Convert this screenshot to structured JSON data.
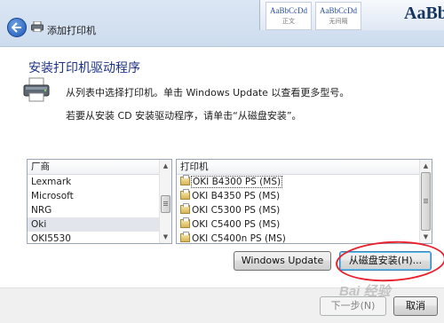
{
  "window": {
    "title": "添加打印机"
  },
  "office_ribbon": {
    "tiles": [
      {
        "sample": "AaBbCcDd",
        "name": "正文"
      },
      {
        "sample": "AaBbCcDd",
        "name": "无间隔"
      }
    ],
    "big_sample": "AaBb"
  },
  "page": {
    "heading": "安装打印机驱动程序",
    "instruction1": "从列表中选择打印机。单击 Windows Update 以查看更多型号。",
    "instruction2": "若要从安装 CD 安装驱动程序，请单击“从磁盘安装”。"
  },
  "manufacturers": {
    "header": "厂商",
    "items": [
      "Lexmark",
      "Microsoft",
      "NRG",
      "Oki",
      "OKI5530"
    ],
    "selected": "Oki"
  },
  "printers": {
    "header": "打印机",
    "items": [
      "OKI B4300 PS (MS)",
      "OKI B4350 PS (MS)",
      "OKI C5300 PS (MS)",
      "OKI C5400 PS (MS)",
      "OKI C5400n PS (MS)"
    ],
    "focused": "OKI B4300 PS (MS)"
  },
  "buttons": {
    "windows_update": "Windows Update",
    "have_disk": "从磁盘安装(H)...",
    "next": "下一步(N)",
    "cancel": "取消"
  },
  "annotation": {
    "color": "#e8232f"
  },
  "watermark": "Bai 经验"
}
